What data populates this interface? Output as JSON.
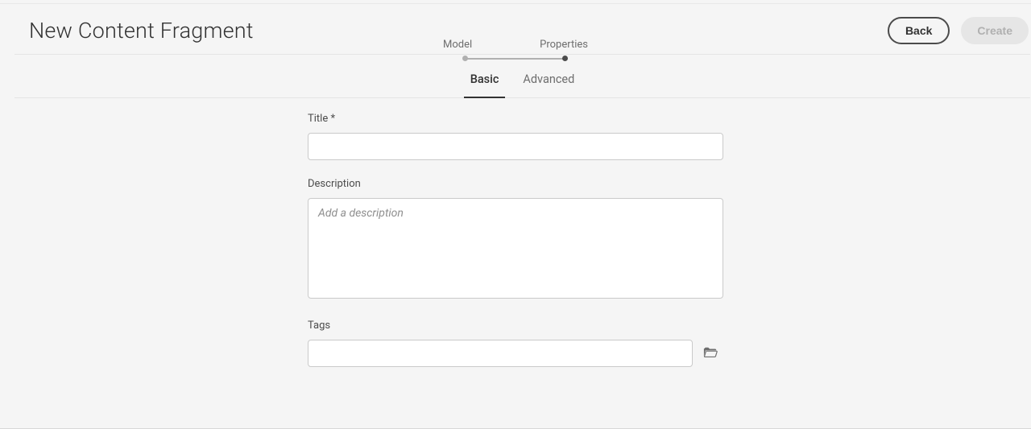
{
  "page": {
    "title": "New Content Fragment"
  },
  "stepper": {
    "steps": [
      "Model",
      "Properties"
    ],
    "active_index": 1
  },
  "actions": {
    "back_label": "Back",
    "create_label": "Create",
    "create_disabled": true
  },
  "tabs": {
    "items": [
      "Basic",
      "Advanced"
    ],
    "active_index": 0
  },
  "form": {
    "title": {
      "label": "Title *",
      "value": ""
    },
    "description": {
      "label": "Description",
      "placeholder": "Add a description",
      "value": ""
    },
    "tags": {
      "label": "Tags",
      "value": ""
    }
  }
}
